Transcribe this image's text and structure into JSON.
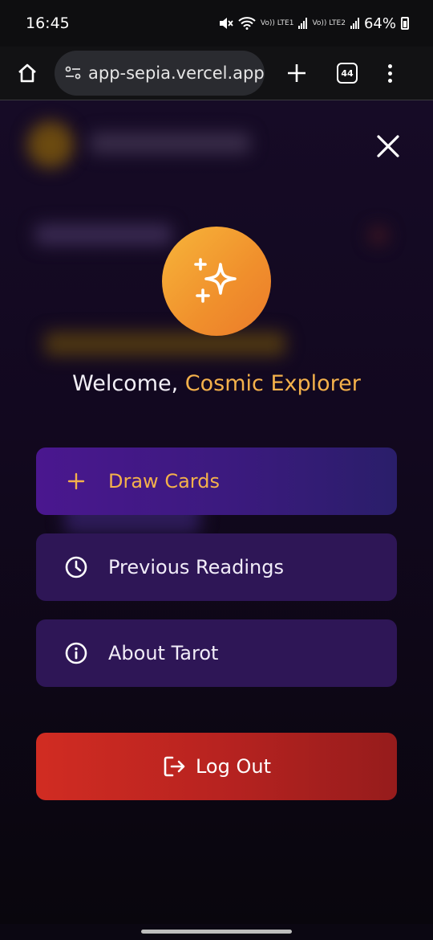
{
  "status_bar": {
    "time": "16:45",
    "sim1_label": "Vo)) LTE1",
    "sim2_label": "Vo)) LTE2",
    "battery": "64%",
    "icons": [
      "mute-icon",
      "wifi-icon",
      "signal-icon",
      "battery-icon"
    ]
  },
  "browser": {
    "url": "app-sepia.vercel.app",
    "tab_count": "44",
    "icons": [
      "home-icon",
      "site-info-icon",
      "new-tab-icon",
      "tabs-icon",
      "more-menu-icon"
    ]
  },
  "overlay": {
    "welcome_prefix": "Welcome, ",
    "user_name": "Cosmic Explorer",
    "menu": [
      {
        "label": "Draw Cards",
        "icon": "plus-icon"
      },
      {
        "label": "Previous Readings",
        "icon": "clock-icon"
      },
      {
        "label": "About Tarot",
        "icon": "info-icon"
      }
    ],
    "logout_label": "Log Out",
    "logout_icon": "logout-icon",
    "avatar_icon": "sparkles-icon",
    "close_icon": "close-icon"
  },
  "colors": {
    "accent": "#f4b14b",
    "menu_bg": "#2e1656",
    "draw_bg": "#4a178f",
    "logout_bg": "#c4261f",
    "page_bg": "#12081f"
  }
}
